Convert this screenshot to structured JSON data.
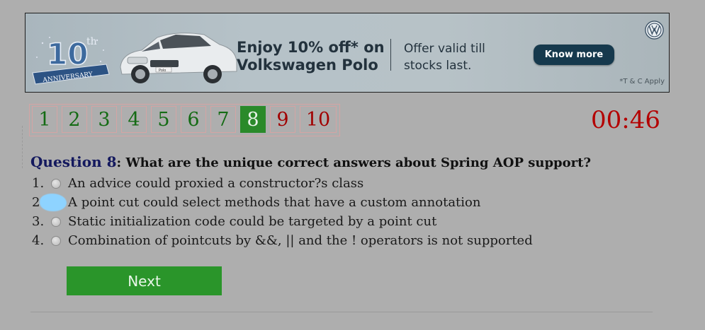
{
  "banner": {
    "anniversary_number": "10",
    "anniversary_suffix": "th",
    "anniversary_text": "ANNIVERSARY",
    "headline_line1": "Enjoy 10% off* on",
    "headline_line2": "Volkswagen Polo",
    "offer_line1": "Offer valid till",
    "offer_line2": "stocks last.",
    "cta_label": "Know more",
    "disclaimer": "*T & C Apply",
    "car_plate": "Polo",
    "logo_icon": "vw-logo-icon"
  },
  "navigator": {
    "questions": [
      "1",
      "2",
      "3",
      "4",
      "5",
      "6",
      "7",
      "8",
      "9",
      "10"
    ],
    "active": "8"
  },
  "timer": "00:46",
  "question": {
    "label": "Question 8",
    "text": ": What are the unique correct answers about Spring AOP support?"
  },
  "answers": [
    {
      "num": "1.",
      "text": "An advice could proxied a constructor?s class"
    },
    {
      "num": "2.",
      "text": "A point cut could select methods that have a custom annotation"
    },
    {
      "num": "3.",
      "text": "Static initialization code could be targeted by a point cut"
    },
    {
      "num": "4.",
      "text": "Combination of pointcuts by &&, || and the ! operators is not supported"
    }
  ],
  "next_label": "Next",
  "colors": {
    "page_bg": "#aeaeae",
    "nav_green": "#146b14",
    "nav_red": "#a10000",
    "active_bg": "#2a8a2a",
    "timer": "#b40000",
    "next_bg": "#2a952a",
    "cta_bg": "#16394d"
  }
}
